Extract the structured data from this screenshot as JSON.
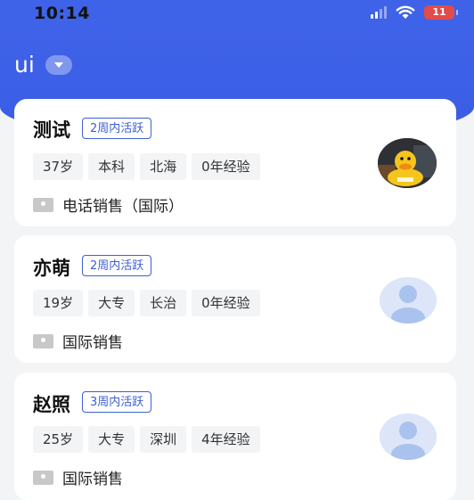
{
  "status_bar": {
    "time": "10:14",
    "battery": "11"
  },
  "header": {
    "city": "ui"
  },
  "candidates": [
    {
      "name": "测试",
      "active": "2周内活跃",
      "tags": [
        "37岁",
        "本科",
        "北海",
        "0年经验"
      ],
      "job": "电话销售（国际）",
      "avatar": "duck-photo-avatar"
    },
    {
      "name": "亦萌",
      "active": "2周内活跃",
      "tags": [
        "19岁",
        "大专",
        "长治",
        "0年经验"
      ],
      "job": "国际销售",
      "avatar": "default-person-avatar"
    },
    {
      "name": "赵照",
      "active": "3周内活跃",
      "tags": [
        "25岁",
        "大专",
        "深圳",
        "4年经验"
      ],
      "job": "国际销售",
      "avatar": "default-person-avatar"
    }
  ],
  "colors": {
    "header_blue": "#3f63e8",
    "badge_blue": "#3d5fd6",
    "battery_red": "#e14b4b"
  }
}
